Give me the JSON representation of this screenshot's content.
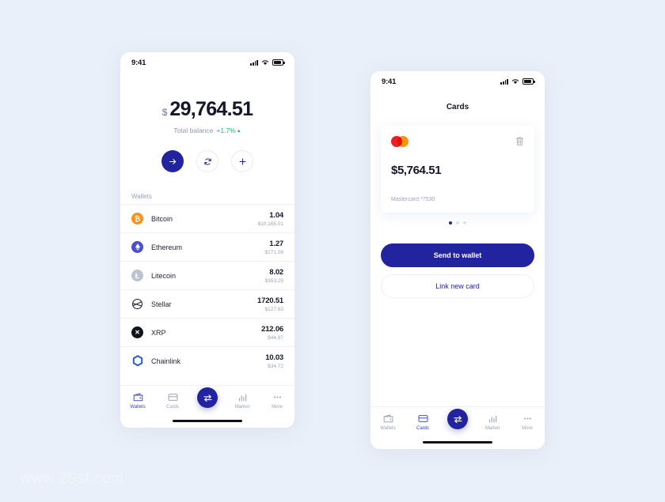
{
  "watermark": "www.2Sst.com",
  "theme": {
    "background": "#eaf0f9",
    "primary": "#21249e",
    "accent_green": "#25b27f",
    "text_dark": "#14162a",
    "text_muted": "#9aa5b8"
  },
  "phone_wallets": {
    "status_bar": {
      "time": "9:41",
      "signal_icon": "signal-bars-icon",
      "wifi_icon": "wifi-icon",
      "battery_icon": "battery-icon"
    },
    "balance": {
      "currency_symbol": "$",
      "amount": "29,764.51",
      "label": "Total balance",
      "change": "+1.7%",
      "change_caret": "▲"
    },
    "actions": [
      {
        "name": "send-button",
        "icon": "arrow-right-icon"
      },
      {
        "name": "swap-button",
        "icon": "refresh-icon"
      },
      {
        "name": "add-button",
        "icon": "plus-icon"
      }
    ],
    "wallets_label": "Wallets",
    "wallets": [
      {
        "name": "Bitcoin",
        "symbol": "₿",
        "amount": "1.04",
        "usd": "$10,165.01",
        "color": "#f7931a",
        "icon": "bitcoin-icon"
      },
      {
        "name": "Ethereum",
        "symbol": "◆",
        "amount": "1.27",
        "usd": "$271.06",
        "color": "#4a4ed1",
        "icon": "ethereum-icon"
      },
      {
        "name": "Litecoin",
        "symbol": "Ł",
        "amount": "8.02",
        "usd": "$353.29",
        "color": "#bdc3ce",
        "icon": "litecoin-icon"
      },
      {
        "name": "Stellar",
        "symbol": "✧",
        "amount": "1720.51",
        "usd": "$127.63",
        "color": "#2b2f3a",
        "icon": "stellar-icon"
      },
      {
        "name": "XRP",
        "symbol": "✕",
        "amount": "212.06",
        "usd": "$44.97",
        "color": "#11131a",
        "icon": "xrp-icon"
      },
      {
        "name": "Chainlink",
        "symbol": "⬡",
        "amount": "10.03",
        "usd": "$34.72",
        "color": "#2a5ada",
        "icon": "chainlink-icon"
      }
    ],
    "tabs": [
      {
        "label": "Wallets",
        "icon": "wallet-icon",
        "active": true
      },
      {
        "label": "Cards",
        "icon": "card-icon",
        "active": false
      },
      {
        "label": "",
        "icon": "exchange-icon",
        "active": false
      },
      {
        "label": "Market",
        "icon": "chart-icon",
        "active": false
      },
      {
        "label": "More",
        "icon": "ellipsis-icon",
        "active": false
      }
    ]
  },
  "phone_cards": {
    "status_bar": {
      "time": "9:41",
      "signal_icon": "signal-bars-icon",
      "wifi_icon": "wifi-icon",
      "battery_icon": "battery-icon"
    },
    "title": "Cards",
    "card": {
      "brand_icon": "mastercard-icon",
      "delete_icon": "trash-icon",
      "amount": "$5,764.51",
      "meta": "Mastercard *7530"
    },
    "pagination": {
      "count": 3,
      "active_index": 0
    },
    "primary_button": "Send to wallet",
    "secondary_button": "Link new card",
    "tabs": [
      {
        "label": "Wallets",
        "icon": "wallet-icon",
        "active": false
      },
      {
        "label": "Cards",
        "icon": "card-icon",
        "active": true
      },
      {
        "label": "",
        "icon": "exchange-icon",
        "active": false
      },
      {
        "label": "Market",
        "icon": "chart-icon",
        "active": false
      },
      {
        "label": "More",
        "icon": "ellipsis-icon",
        "active": false
      }
    ]
  }
}
